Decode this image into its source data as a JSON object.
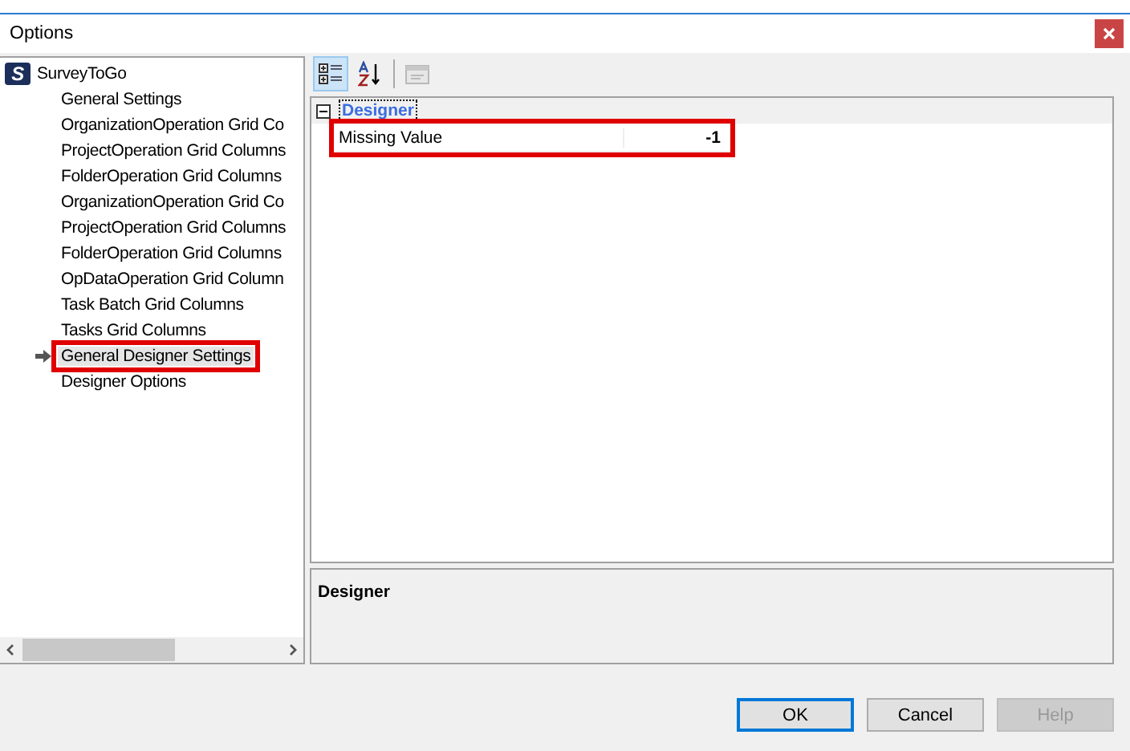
{
  "window": {
    "title": "Options"
  },
  "tree": {
    "root": {
      "logo_text": "S",
      "label": "SurveyToGo",
      "children": [
        {
          "label": "General Settings",
          "selected": false,
          "highlighted": false
        },
        {
          "label": "OrganizationOperation Grid Co",
          "selected": false,
          "highlighted": false
        },
        {
          "label": "ProjectOperation Grid Columns",
          "selected": false,
          "highlighted": false
        },
        {
          "label": "FolderOperation Grid Columns",
          "selected": false,
          "highlighted": false
        },
        {
          "label": "OrganizationOperation Grid Co",
          "selected": false,
          "highlighted": false
        },
        {
          "label": "ProjectOperation Grid Columns",
          "selected": false,
          "highlighted": false
        },
        {
          "label": "FolderOperation Grid Columns",
          "selected": false,
          "highlighted": false
        },
        {
          "label": "OpDataOperation Grid Column",
          "selected": false,
          "highlighted": false
        },
        {
          "label": "Task Batch Grid Columns",
          "selected": false,
          "highlighted": false
        },
        {
          "label": "Tasks Grid Columns",
          "selected": false,
          "highlighted": false
        },
        {
          "label": "General Designer Settings",
          "selected": true,
          "highlighted": true
        },
        {
          "label": "Designer Options",
          "selected": false,
          "highlighted": false
        }
      ]
    }
  },
  "toolbar": [
    {
      "kind": "categorized",
      "selected": true,
      "disabled": false
    },
    {
      "kind": "alphabetical",
      "selected": false,
      "disabled": false
    },
    {
      "kind": "pages",
      "selected": false,
      "disabled": true
    }
  ],
  "property_grid": {
    "categories": [
      {
        "name": "Designer",
        "expanded": true,
        "rows": [
          {
            "name": "Missing Value",
            "value": "-1",
            "highlighted": true
          }
        ]
      }
    ]
  },
  "description": {
    "title": "Designer"
  },
  "buttons": [
    {
      "label": "OK",
      "default": true,
      "disabled": false
    },
    {
      "label": "Cancel",
      "default": false,
      "disabled": false
    },
    {
      "label": "Help",
      "default": false,
      "disabled": true
    }
  ]
}
